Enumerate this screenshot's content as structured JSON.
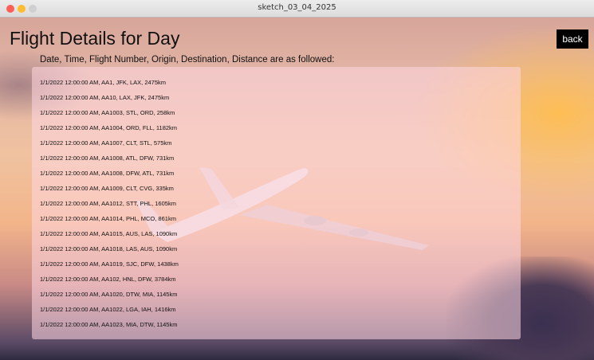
{
  "window": {
    "title": "sketch_03_04_2025"
  },
  "header": {
    "title": "Flight Details for Day",
    "back_label": "back",
    "subtitle": "Date, Time, Flight Number, Origin, Destination, Distance are as followed:"
  },
  "flights": [
    "1/1/2022 12:00:00 AM, AA1, JFK, LAX, 2475km",
    "1/1/2022 12:00:00 AM, AA10, LAX, JFK, 2475km",
    "1/1/2022 12:00:00 AM, AA1003, STL, ORD, 258km",
    "1/1/2022 12:00:00 AM, AA1004, ORD, FLL, 1182km",
    "1/1/2022 12:00:00 AM, AA1007, CLT, STL, 575km",
    "1/1/2022 12:00:00 AM, AA1008, ATL, DFW, 731km",
    "1/1/2022 12:00:00 AM, AA1008, DFW, ATL, 731km",
    "1/1/2022 12:00:00 AM, AA1009, CLT, CVG, 335km",
    "1/1/2022 12:00:00 AM, AA1012, STT, PHL, 1605km",
    "1/1/2022 12:00:00 AM, AA1014, PHL, MCO, 861km",
    "1/1/2022 12:00:00 AM, AA1015, AUS, LAS, 1090km",
    "1/1/2022 12:00:00 AM, AA1018, LAS, AUS, 1090km",
    "1/1/2022 12:00:00 AM, AA1019, SJC, DFW, 1438km",
    "1/1/2022 12:00:00 AM, AA102, HNL, DFW, 3784km",
    "1/1/2022 12:00:00 AM, AA1020, DTW, MIA, 1145km",
    "1/1/2022 12:00:00 AM, AA1022, LGA, IAH, 1416km",
    "1/1/2022 12:00:00 AM, AA1023, MIA, DTW, 1145km"
  ],
  "colors": {
    "back_button_bg": "#000000",
    "panel_tint": "#ffd7e1",
    "traffic_red": "#fe5f57",
    "traffic_yellow": "#febc2e"
  }
}
